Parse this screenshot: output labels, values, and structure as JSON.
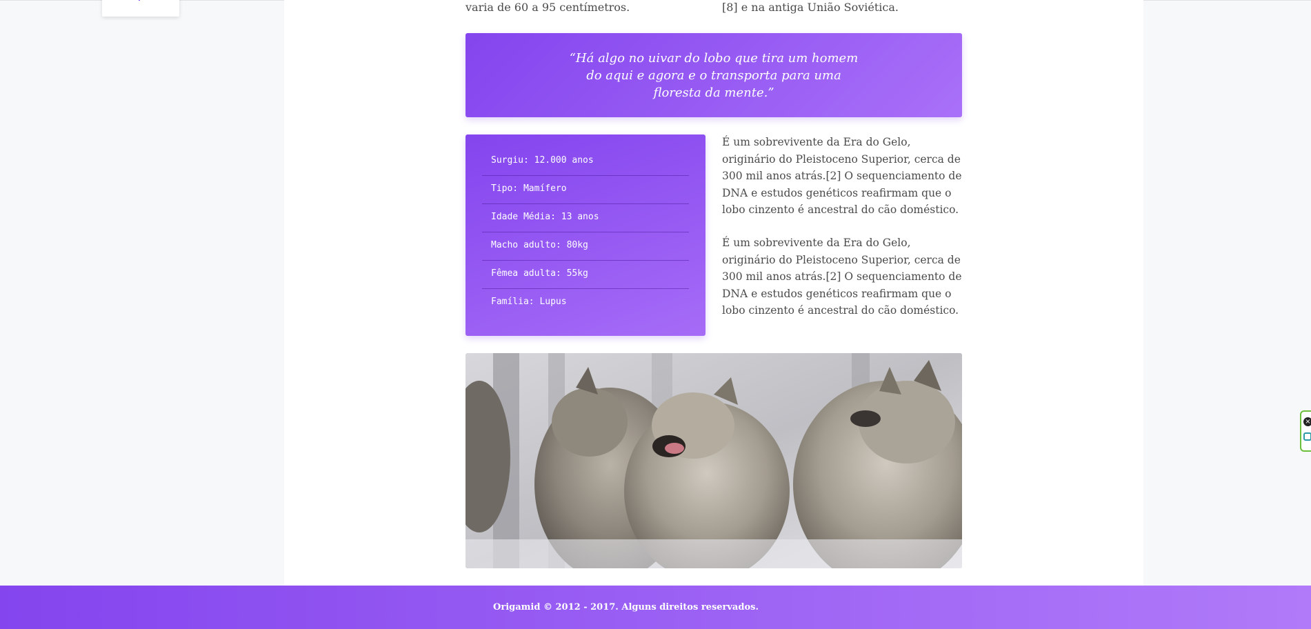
{
  "top": {
    "left_text": "varia de 60 a 95 centímetros.",
    "right_text": "[8] e na antiga União Soviética."
  },
  "quote": {
    "text": "“Há algo no uivar do lobo que tira um homem do aqui e agora e o transporta para uma floresta da mente.”"
  },
  "facts": [
    {
      "text": "Surgiu: 12.000 anos"
    },
    {
      "text": "Tipo: Mamífero"
    },
    {
      "text": "Idade Média: 13 anos"
    },
    {
      "text": "Macho adulto: 80kg"
    },
    {
      "text": "Fêmea adulta: 55kg"
    },
    {
      "text": "Família: Lupus"
    }
  ],
  "paragraphs": [
    {
      "text": "É um sobrevivente da Era do Gelo, originário do Pleistoceno Superior, cerca de 300 mil anos atrás.[2] O sequenciamento de DNA e estudos genéticos reafirmam que o lobo cinzento é ancestral do cão doméstico."
    },
    {
      "text": "É um sobrevivente da Era do Gelo, originário do Pleistoceno Superior, cerca de 300 mil anos atrás.[2] O sequenciamento de DNA e estudos genéticos reafirmam que o lobo cinzento é ancestral do cão doméstico."
    }
  ],
  "footer": {
    "text": "Origamid © 2012 - 2017. Alguns direitos reservados."
  },
  "icons": {
    "menu_indicator": "menu-indicator-icon",
    "extension_close": "close-icon",
    "extension_action": "extension-icon"
  },
  "colors": {
    "accent_start": "#8445ee",
    "accent_end": "#b07af9"
  }
}
